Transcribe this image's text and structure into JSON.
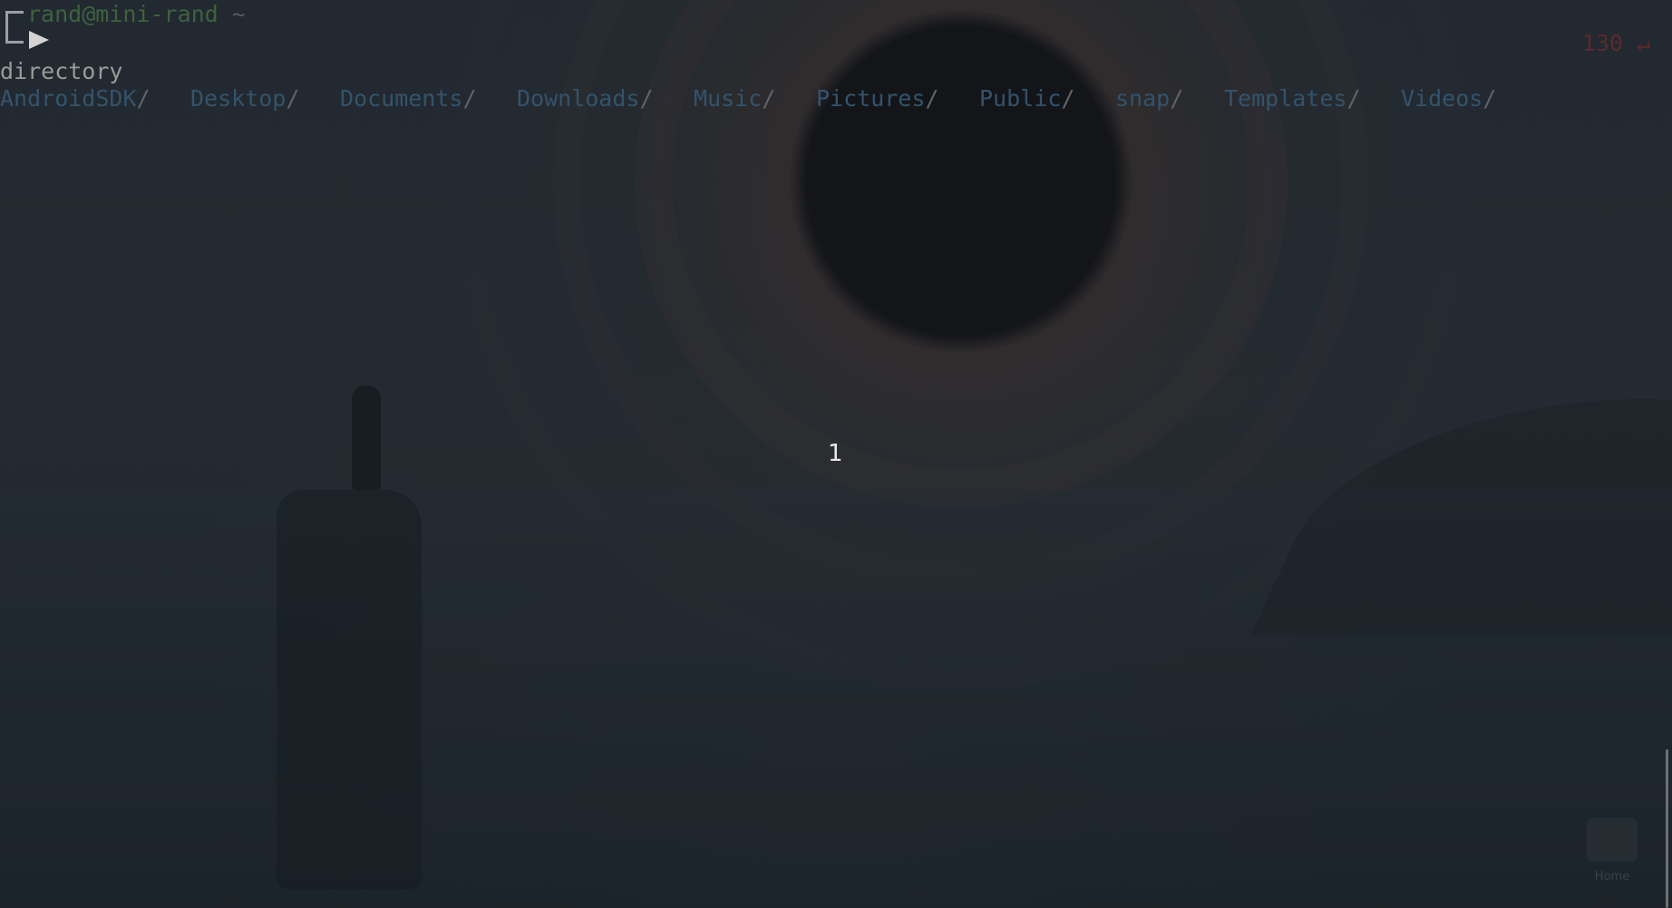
{
  "terminal": {
    "prompt": {
      "user_host": "rand@mini-rand",
      "cwd": "~",
      "exit_status": "130 ↵"
    },
    "output_line": "directory",
    "directories": [
      "AndroidSDK",
      "Desktop",
      "Documents",
      "Downloads",
      "Music",
      "Pictures",
      "Public",
      "snap",
      "Templates",
      "Videos"
    ],
    "dir_suffix": "/"
  },
  "workspace": {
    "number": "1"
  },
  "desktop": {
    "home_label": "Home"
  },
  "colors": {
    "user_host": "#3e6240",
    "directory": "#34536b",
    "exit_status": "#5a2a2a",
    "text": "#9a9a9a"
  },
  "icons": {
    "prompt_bracket": "prompt-bracket-icon",
    "prompt_arrow": "prompt-arrow-icon",
    "home": "home-folder-icon"
  }
}
